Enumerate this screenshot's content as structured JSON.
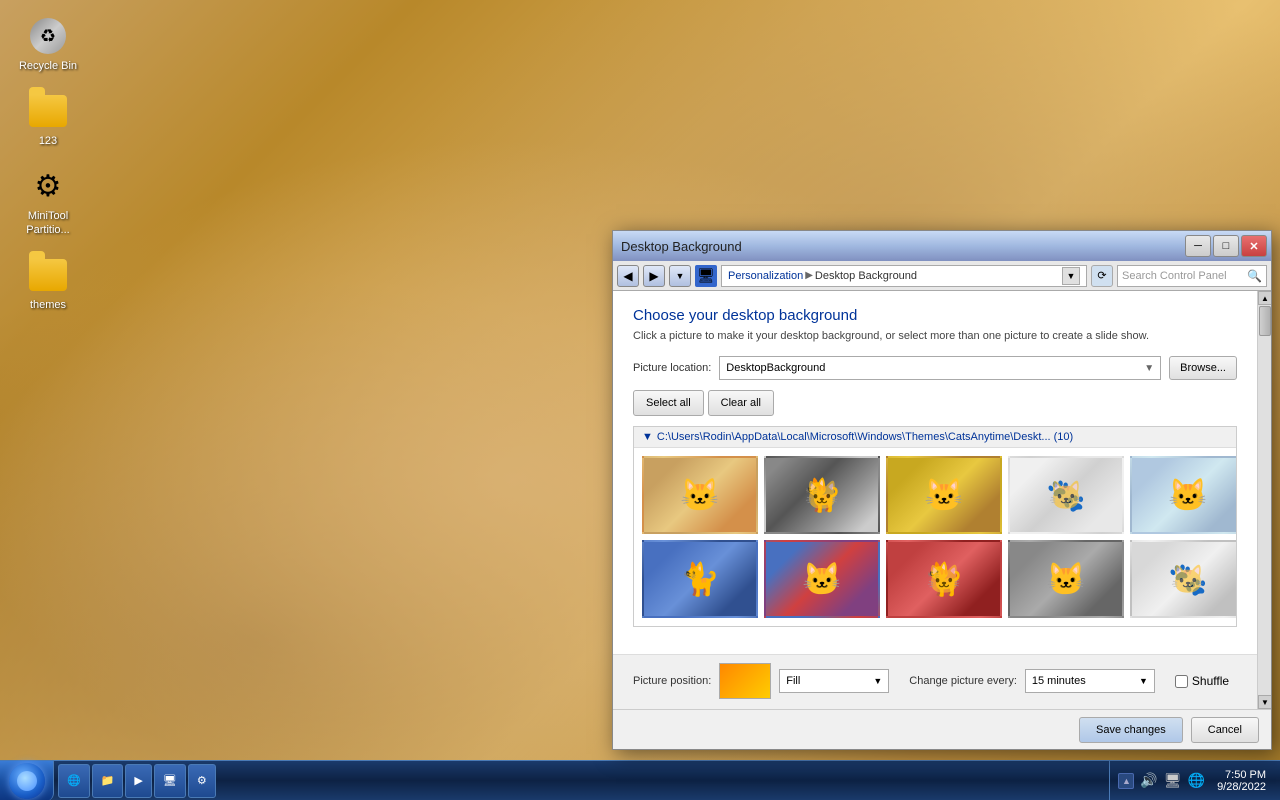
{
  "desktop": {
    "icons": [
      {
        "id": "recycle-bin",
        "label": "Recycle Bin",
        "type": "recycle",
        "emoji": "🗑"
      },
      {
        "id": "folder-123",
        "label": "123",
        "type": "folder"
      },
      {
        "id": "minitool",
        "label": "MiniTool\nPartitio...",
        "type": "app",
        "emoji": "🔧"
      },
      {
        "id": "themes",
        "label": "themes",
        "type": "folder"
      }
    ]
  },
  "taskbar": {
    "start_label": "",
    "items": [
      {
        "id": "ie",
        "emoji": "🌐"
      },
      {
        "id": "explorer",
        "emoji": "📁"
      },
      {
        "id": "media",
        "emoji": "▶"
      },
      {
        "id": "network",
        "emoji": "🖥"
      },
      {
        "id": "cp",
        "emoji": "🖥"
      }
    ],
    "tray": {
      "icons": [
        "▲",
        "🔊",
        "🖥",
        "🌐"
      ],
      "time": "7:50 PM",
      "date": "9/28/2022"
    }
  },
  "dialog": {
    "title": "Desktop Background",
    "nav": {
      "back_title": "Back",
      "forward_title": "Forward",
      "breadcrumb": [
        "Personalization",
        "Desktop Background"
      ]
    },
    "search_placeholder": "Search Control Panel",
    "heading": "Choose your desktop background",
    "subtitle": "Click a picture to make it your desktop background, or select more than one picture to create a slide show.",
    "picture_location_label": "Picture location:",
    "picture_location_value": "DesktopBackground",
    "browse_label": "Browse...",
    "select_all_label": "Select all",
    "clear_all_label": "Clear all",
    "folder_path": "C:\\Users\\Rodin\\AppData\\Local\\Microsoft\\Windows\\Themes\\CatsAnytime\\Deskt... (10)",
    "images": [
      {
        "id": "img1",
        "class": "cat1",
        "selected": false
      },
      {
        "id": "img2",
        "class": "cat2",
        "selected": false
      },
      {
        "id": "img3",
        "class": "cat3",
        "selected": false
      },
      {
        "id": "img4",
        "class": "cat4",
        "selected": false
      },
      {
        "id": "img5",
        "class": "cat5",
        "selected": false
      },
      {
        "id": "img6",
        "class": "cat6",
        "selected": false
      },
      {
        "id": "img7",
        "class": "cat7",
        "selected": false
      },
      {
        "id": "img8",
        "class": "cat8",
        "selected": false
      },
      {
        "id": "img9",
        "class": "cat9",
        "selected": false
      },
      {
        "id": "img10",
        "class": "cat10",
        "selected": false
      }
    ],
    "picture_position_label": "Picture position:",
    "fill_value": "Fill",
    "change_picture_label": "Change picture every:",
    "interval_value": "15 minutes",
    "shuffle_label": "Shuffle",
    "save_label": "Save changes",
    "cancel_label": "Cancel"
  }
}
